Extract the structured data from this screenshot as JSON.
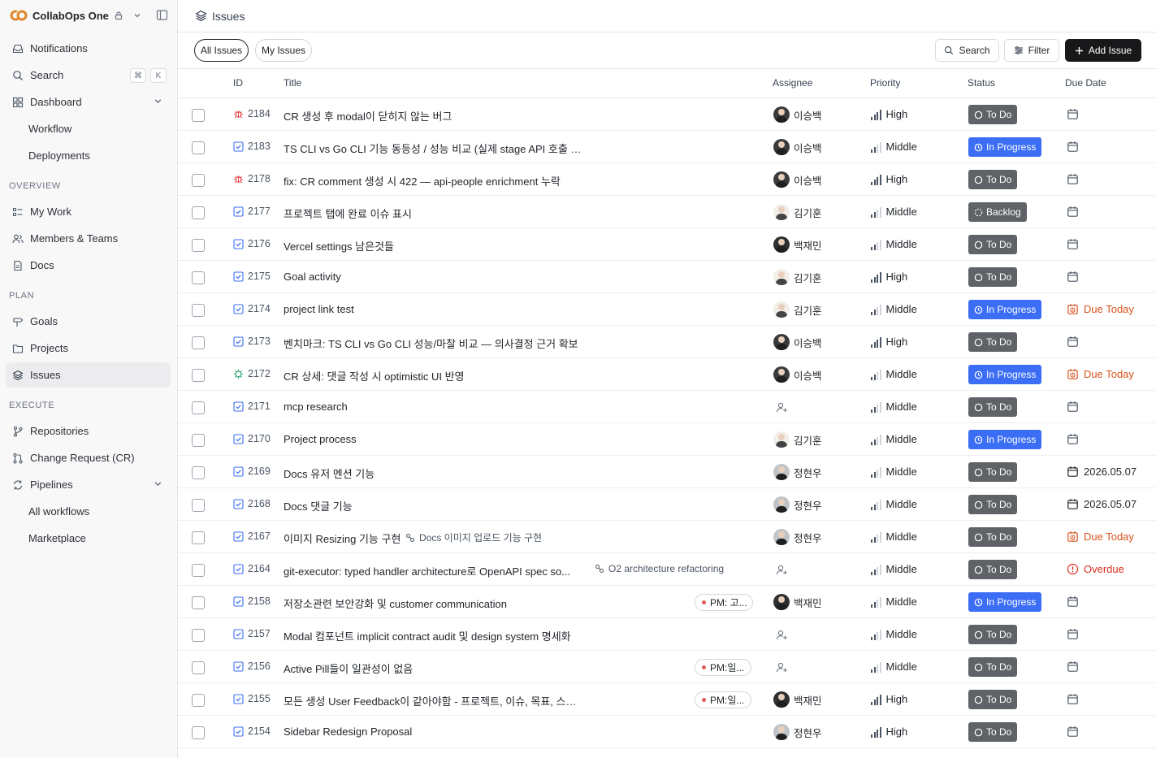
{
  "workspace": {
    "name": "CollabOps One"
  },
  "sidebar": {
    "notifications": "Notifications",
    "search": "Search",
    "shortcut": [
      "⌘",
      "K"
    ],
    "dashboard": "Dashboard",
    "workflow": "Workflow",
    "deployments": "Deployments",
    "overview_label": "OVERVIEW",
    "my_work": "My Work",
    "members_teams": "Members & Teams",
    "docs": "Docs",
    "plan_label": "PLAN",
    "goals": "Goals",
    "projects": "Projects",
    "issues": "Issues",
    "execute_label": "EXECUTE",
    "repositories": "Repositories",
    "change_request": "Change Request (CR)",
    "pipelines": "Pipelines",
    "all_workflows": "All workflows",
    "marketplace": "Marketplace"
  },
  "header": {
    "title": "Issues"
  },
  "toolbar": {
    "all_issues": "All Issues",
    "my_issues": "My Issues",
    "search": "Search",
    "filter": "Filter",
    "add_issue": "Add Issue"
  },
  "table": {
    "columns": [
      "ID",
      "Title",
      "Assignee",
      "Priority",
      "Status",
      "Due Date"
    ],
    "rows": [
      {
        "type": "bug",
        "id": "2184",
        "title": "CR 생성 후 modal이 닫히지 않는 버그",
        "assignee": "이승백",
        "avatar": "a1",
        "priority": "High",
        "status": "To Do",
        "status_kind": "todo",
        "due": "",
        "due_kind": "none"
      },
      {
        "type": "task",
        "id": "2183",
        "title": "TS CLI vs Go CLI 기능 동등성 / 성능 비교 (실제 stage API 호출 기반)",
        "assignee": "이승백",
        "avatar": "a1",
        "priority": "Middle",
        "status": "In Progress",
        "status_kind": "progress",
        "due": "",
        "due_kind": "none"
      },
      {
        "type": "bug",
        "id": "2178",
        "title": "fix: CR comment 생성 시 422 — api-people enrichment 누락",
        "assignee": "이승백",
        "avatar": "a1",
        "priority": "High",
        "status": "To Do",
        "status_kind": "todo",
        "due": "",
        "due_kind": "none"
      },
      {
        "type": "task",
        "id": "2177",
        "title": "프로젝트 탭에 완료 이슈 표시",
        "assignee": "김기훈",
        "avatar": "a2",
        "priority": "Middle",
        "status": "Backlog",
        "status_kind": "backlog",
        "due": "",
        "due_kind": "none"
      },
      {
        "type": "task",
        "id": "2176",
        "title": "Vercel settings 남은것들",
        "assignee": "백재민",
        "avatar": "a3",
        "priority": "Middle",
        "status": "To Do",
        "status_kind": "todo",
        "due": "",
        "due_kind": "none"
      },
      {
        "type": "task",
        "id": "2175",
        "title": "Goal activity",
        "assignee": "김기훈",
        "avatar": "a2",
        "priority": "High",
        "status": "To Do",
        "status_kind": "todo",
        "due": "",
        "due_kind": "none"
      },
      {
        "type": "task",
        "id": "2174",
        "title": "project link test",
        "assignee": "김기훈",
        "avatar": "a2",
        "priority": "Middle",
        "status": "In Progress",
        "status_kind": "progress",
        "due": "Due Today",
        "due_kind": "today"
      },
      {
        "type": "task",
        "id": "2173",
        "title": "벤치마크: TS CLI vs Go CLI 성능/마찰 비교 — 의사결정 근거 확보",
        "assignee": "이승백",
        "avatar": "a1",
        "priority": "High",
        "status": "To Do",
        "status_kind": "todo",
        "due": "",
        "due_kind": "none"
      },
      {
        "type": "feature",
        "id": "2172",
        "title": "CR 상세: 댓글 작성 시 optimistic UI 반영",
        "assignee": "이승백",
        "avatar": "a1",
        "priority": "Middle",
        "status": "In Progress",
        "status_kind": "progress",
        "due": "Due Today",
        "due_kind": "today"
      },
      {
        "type": "task",
        "id": "2171",
        "title": "mcp research",
        "assignee": "",
        "avatar": "",
        "priority": "Middle",
        "status": "To Do",
        "status_kind": "todo",
        "due": "",
        "due_kind": "none"
      },
      {
        "type": "task",
        "id": "2170",
        "title": "Project process",
        "assignee": "김기훈",
        "avatar": "a2",
        "priority": "Middle",
        "status": "In Progress",
        "status_kind": "progress",
        "due": "",
        "due_kind": "none"
      },
      {
        "type": "task",
        "id": "2169",
        "title": "Docs 유저 멘션 기능",
        "assignee": "정현우",
        "avatar": "a4",
        "priority": "Middle",
        "status": "To Do",
        "status_kind": "todo",
        "due": "2026.05.07",
        "due_kind": "date"
      },
      {
        "type": "task",
        "id": "2168",
        "title": "Docs 댓글 기능",
        "assignee": "정현우",
        "avatar": "a4",
        "priority": "Middle",
        "status": "To Do",
        "status_kind": "todo",
        "due": "2026.05.07",
        "due_kind": "date"
      },
      {
        "type": "task",
        "id": "2167",
        "title": "이미지 Resizing 기능 구현",
        "sub_issue": "Docs 이미지 업로드 기능 구현",
        "assignee": "정현우",
        "avatar": "a4",
        "priority": "Middle",
        "status": "To Do",
        "status_kind": "todo",
        "due": "Due Today",
        "due_kind": "today"
      },
      {
        "type": "task",
        "id": "2164",
        "title": "git-executor: typed handler architecture로 OpenAPI spec so...",
        "sub_issue": "O2 architecture refactoring",
        "assignee": "",
        "avatar": "",
        "priority": "Middle",
        "status": "To Do",
        "status_kind": "todo",
        "due": "Overdue",
        "due_kind": "overdue"
      },
      {
        "type": "task",
        "id": "2158",
        "title": "저장소관련 보안강화 및 customer communication",
        "tag": "PM: 고...",
        "assignee": "백재민",
        "avatar": "a3",
        "priority": "Middle",
        "status": "In Progress",
        "status_kind": "progress",
        "due": "",
        "due_kind": "none"
      },
      {
        "type": "task",
        "id": "2157",
        "title": "Modal 컴포넌트 implicit contract audit 및 design system 명세화",
        "assignee": "",
        "avatar": "",
        "priority": "Middle",
        "status": "To Do",
        "status_kind": "todo",
        "due": "",
        "due_kind": "none"
      },
      {
        "type": "task",
        "id": "2156",
        "title": "Active Pill들이 일관성이 없음",
        "tag": "PM:일...",
        "assignee": "",
        "avatar": "",
        "priority": "Middle",
        "status": "To Do",
        "status_kind": "todo",
        "due": "",
        "due_kind": "none"
      },
      {
        "type": "task",
        "id": "2155",
        "title": "모든 생성 User Feedback이 같아야함 - 프로젝트, 이슈, 목표, 스프린트, 저장소, 변경요청,...",
        "tag": "PM:일...",
        "assignee": "백재민",
        "avatar": "a3",
        "priority": "High",
        "status": "To Do",
        "status_kind": "todo",
        "due": "",
        "due_kind": "none"
      },
      {
        "type": "task",
        "id": "2154",
        "title": "Sidebar Redesign Proposal",
        "assignee": "정현우",
        "avatar": "a4",
        "priority": "High",
        "status": "To Do",
        "status_kind": "todo",
        "due": "",
        "due_kind": "none"
      }
    ]
  },
  "colors": {
    "accent": "#3b6ef5",
    "todo": "#5f6368",
    "due_today": "#d9531e",
    "overdue": "#d92d20",
    "bug": "#e5484d",
    "task": "#3b6ef5",
    "feature": "#30a46c"
  }
}
